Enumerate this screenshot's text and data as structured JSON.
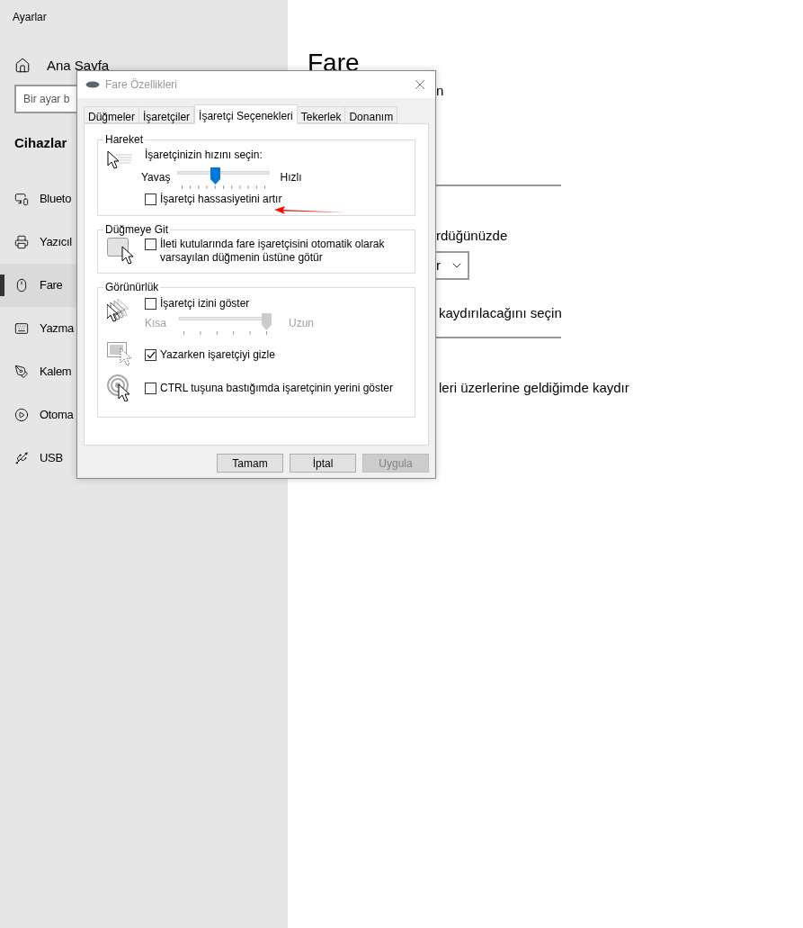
{
  "settings": {
    "title": "Ayarlar",
    "home": "Ana Sayfa",
    "search": {
      "placeholder": "Bir ayar b"
    },
    "section": "Cihazlar",
    "nav": [
      {
        "label": "Blueto",
        "selected": false
      },
      {
        "label": "Yazıcıl",
        "selected": false
      },
      {
        "label": "Fare",
        "selected": true
      },
      {
        "label": "Yazma",
        "selected": false
      },
      {
        "label": "Kalem",
        "selected": false
      },
      {
        "label": "Otoma",
        "selected": false
      },
      {
        "label": "USB",
        "selected": false
      }
    ]
  },
  "main": {
    "title": "Fare",
    "line_1": "n",
    "line_2": "rdüğünüzde",
    "dropdown": {
      "value": "r"
    },
    "line_3": "kaydırılacağını seçin",
    "line_4": "leri üzerlerine geldiğimde kaydır"
  },
  "dialog": {
    "title": "Fare Özellikleri",
    "tabs": [
      {
        "label": "Düğmeler",
        "selected": false
      },
      {
        "label": "İşaretçiler",
        "selected": false
      },
      {
        "label": "İşaretçi Seçenekleri",
        "selected": true
      },
      {
        "label": "Tekerlek",
        "selected": false
      },
      {
        "label": "Donanım",
        "selected": false
      }
    ],
    "motion": {
      "title": "Hareket",
      "speed_label": "İşaretçinizin hızını seçin:",
      "slow": "Yavaş",
      "fast": "Hızlı",
      "speed": {
        "level": 0.4,
        "disabled": false
      },
      "precision": {
        "label": "İşaretçi hassasiyetini artır",
        "checked": false
      }
    },
    "snap": {
      "title": "Düğmeye Git",
      "option": {
        "lines": [
          "İleti kutularında fare işaretçisini otomatik olarak",
          "varsayılan düğmenin üstüne götür"
        ],
        "checked": false
      }
    },
    "visibility": {
      "title": "Görünürlük",
      "trail": {
        "label": "İşaretçi izini göster",
        "checked": false
      },
      "short": "Kısa",
      "long": "Uzun",
      "trail_length": {
        "level": 1,
        "disabled": true
      },
      "hide_typing": {
        "label": "Yazarken işaretçiyi gizle",
        "checked": true
      },
      "ctrl": {
        "label": "CTRL tuşuna bastığımda işaretçinin yerini göster",
        "checked": false
      }
    },
    "buttons": [
      {
        "label": "Tamam",
        "disabled": false
      },
      {
        "label": "İptal",
        "disabled": false
      },
      {
        "label": "Uygula",
        "disabled": true
      }
    ]
  }
}
